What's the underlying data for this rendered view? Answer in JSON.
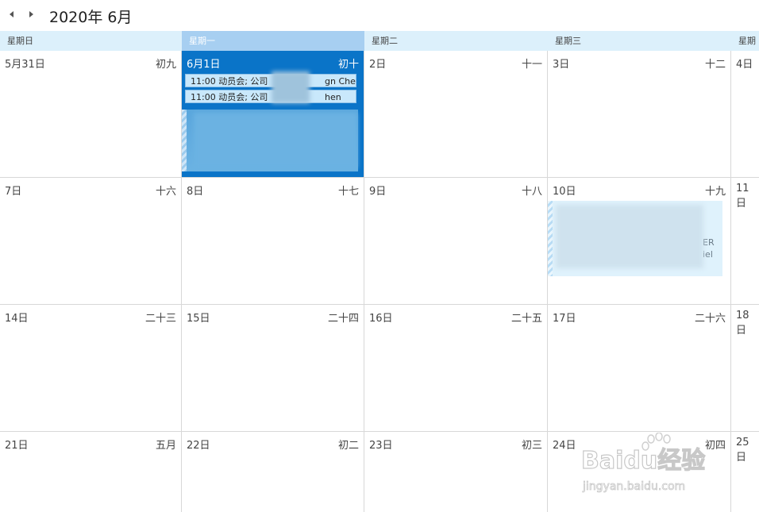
{
  "header": {
    "title": "2020年 6月",
    "prev_icon": "caret-left-icon",
    "next_icon": "caret-right-icon"
  },
  "weekdays": [
    "星期日",
    "星期一",
    "星期二",
    "星期三",
    "星期"
  ],
  "weeks": [
    [
      {
        "date": "5月31日",
        "lunar": "初九"
      },
      {
        "date": "6月1日",
        "lunar": "初十"
      },
      {
        "date": "2日",
        "lunar": "十一"
      },
      {
        "date": "3日",
        "lunar": "十二"
      },
      {
        "date": "4日",
        "lunar": ""
      }
    ],
    [
      {
        "date": "7日",
        "lunar": "十六"
      },
      {
        "date": "8日",
        "lunar": "十七"
      },
      {
        "date": "9日",
        "lunar": "十八"
      },
      {
        "date": "10日",
        "lunar": "十九"
      },
      {
        "date": "11日",
        "lunar": ""
      }
    ],
    [
      {
        "date": "14日",
        "lunar": "二十三"
      },
      {
        "date": "15日",
        "lunar": "二十四"
      },
      {
        "date": "16日",
        "lunar": "二十五"
      },
      {
        "date": "17日",
        "lunar": "二十六"
      },
      {
        "date": "18日",
        "lunar": ""
      }
    ],
    [
      {
        "date": "21日",
        "lunar": "五月"
      },
      {
        "date": "22日",
        "lunar": "初二"
      },
      {
        "date": "23日",
        "lunar": "初三"
      },
      {
        "date": "24日",
        "lunar": "初四"
      },
      {
        "date": "25日",
        "lunar": ""
      }
    ]
  ],
  "events": {
    "june1_a": {
      "time_title": "11:00 动员会; 公司",
      "tail": "gn Chen"
    },
    "june1_b": {
      "time_title": "11:00 动员会; 公司",
      "tail": "hen"
    },
    "june10_fragments": [
      "ER",
      "iel"
    ]
  },
  "watermark": {
    "brand": "Baidu经验",
    "url": "jingyan.baidu.com"
  },
  "colors": {
    "today": "#0a74c8",
    "header_bg": "#dcf0fb",
    "today_header": "#a7cff1",
    "event_bg": "#c9e8fb"
  }
}
